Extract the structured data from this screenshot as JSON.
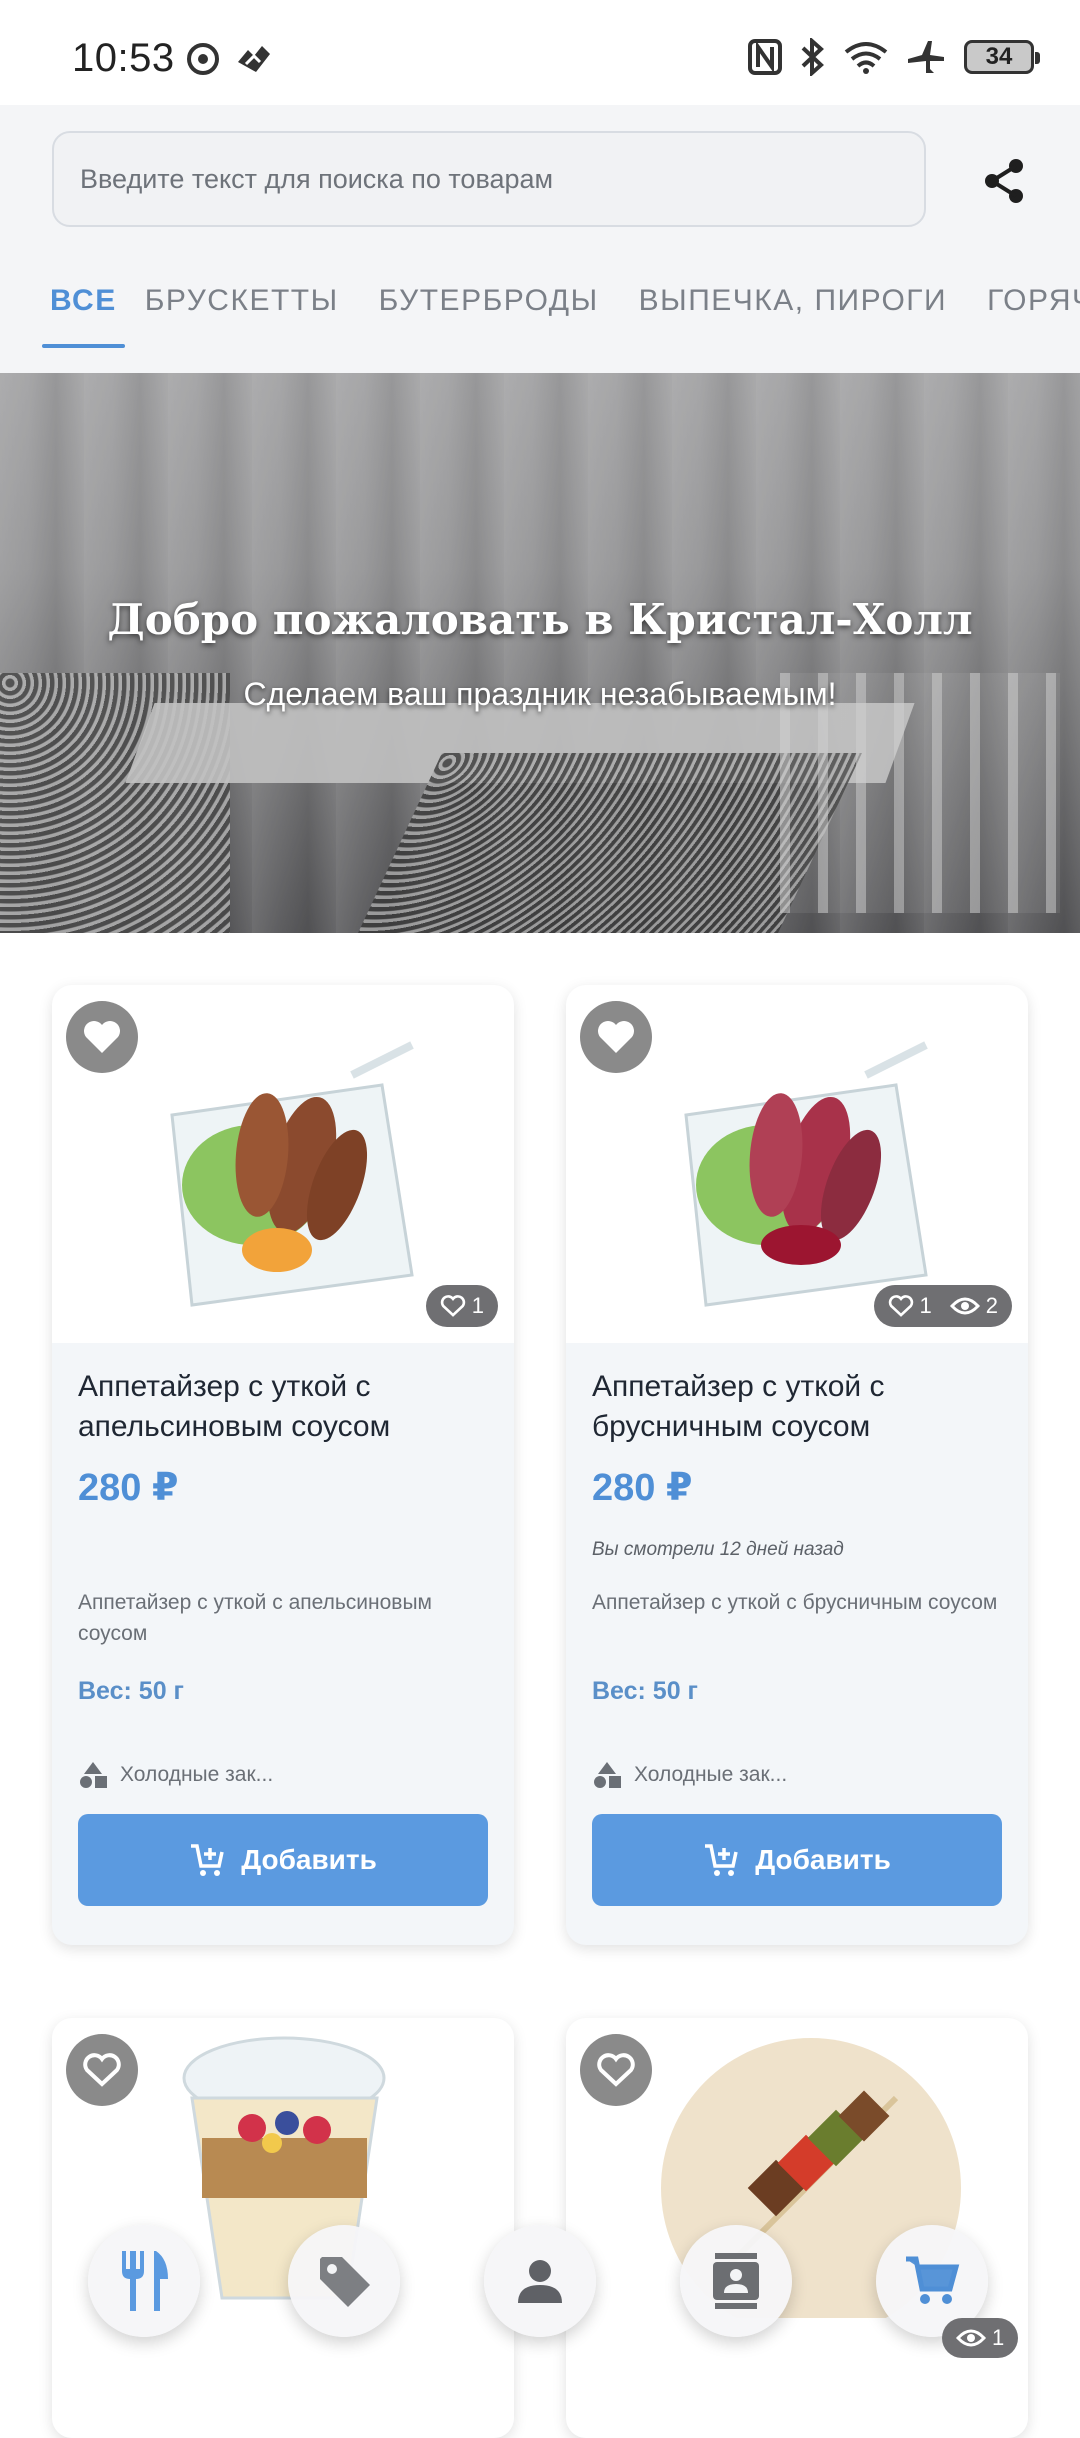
{
  "status_bar": {
    "time": "10:53",
    "battery": "34"
  },
  "search": {
    "placeholder": "Введите текст для поиска по товарам"
  },
  "tabs": [
    {
      "label": "ВСЕ",
      "active": true
    },
    {
      "label": "БРУСКЕТТЫ",
      "active": false
    },
    {
      "label": "БУТЕРБРОДЫ",
      "active": false
    },
    {
      "label": "ВЫПЕЧКА, ПИРОГИ",
      "active": false
    },
    {
      "label": "ГОРЯЧИЕ",
      "active": false
    }
  ],
  "banner": {
    "title": "Добро пожаловать в Кристал-Холл",
    "subtitle": "Сделаем ваш праздник незабываемым!"
  },
  "products": [
    {
      "title": "Аппетайзер с уткой с апельсиновым соусом",
      "price": "280 ₽",
      "viewed": "",
      "description": "Аппетайзер с уткой с апельсиновым соусом",
      "weight": "Вес: 50 г",
      "category": "Холодные зак...",
      "likes": "1",
      "views": "",
      "add_label": "Добавить"
    },
    {
      "title": "Аппетайзер с уткой с брусничным соусом",
      "price": "280 ₽",
      "viewed": "Вы смотрели 12 дней назад",
      "description": "Аппетайзер с уткой с брусничным соусом",
      "weight": "Вес: 50 г",
      "category": "Холодные зак...",
      "likes": "1",
      "views": "2",
      "add_label": "Добавить"
    }
  ],
  "bottom_nav": {
    "items": [
      "fork-knife-icon",
      "tag-icon",
      "person-icon",
      "contacts-icon",
      "cart-icon"
    ],
    "cart_views": "1"
  },
  "colors": {
    "accent": "#4f8fd6",
    "button": "#5b9ae0",
    "card_bg": "#f3f6f9"
  }
}
